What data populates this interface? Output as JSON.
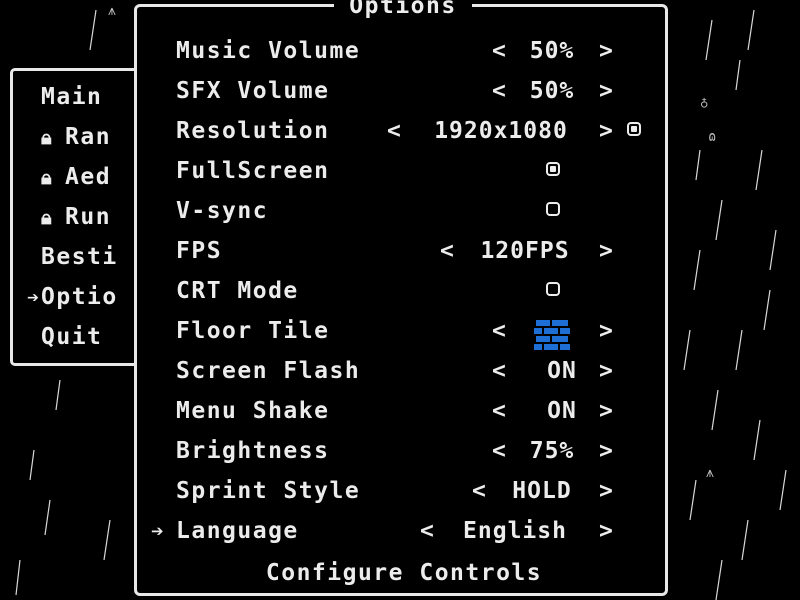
{
  "background": {
    "color": "#000000",
    "rain_color": "#d8d8d8",
    "tree_icon": "tree-icon"
  },
  "main_menu": {
    "items": [
      {
        "label": "Main",
        "locked": false,
        "selected": false
      },
      {
        "label": "Ran",
        "locked": true,
        "selected": false
      },
      {
        "label": "Aed",
        "locked": true,
        "selected": false
      },
      {
        "label": "Run",
        "locked": true,
        "selected": false
      },
      {
        "label": "Besti",
        "locked": false,
        "selected": false
      },
      {
        "label": "Optio",
        "locked": false,
        "selected": true
      },
      {
        "label": "Quit",
        "locked": false,
        "selected": false
      }
    ],
    "lock_icon": "lock-icon",
    "cursor_icon": "arrow-right-icon"
  },
  "options": {
    "title": "Options",
    "rows": [
      {
        "label": "Music Volume",
        "value": "50%",
        "control": "selector"
      },
      {
        "label": "SFX Volume",
        "value": "50%",
        "control": "selector"
      },
      {
        "label": "Resolution",
        "value": "1920x1080",
        "control": "selector",
        "extra_checkbox_on": true
      },
      {
        "label": "FullScreen",
        "checked": true,
        "control": "checkbox"
      },
      {
        "label": "V-sync",
        "checked": false,
        "control": "checkbox"
      },
      {
        "label": "FPS",
        "value": "120FPS",
        "control": "selector"
      },
      {
        "label": "CRT Mode",
        "checked": false,
        "control": "checkbox"
      },
      {
        "label": "Floor Tile",
        "control": "tile",
        "tile_color": "#1d6fd6"
      },
      {
        "label": "Screen Flash",
        "value": "ON",
        "control": "selector"
      },
      {
        "label": "Menu Shake",
        "value": "ON",
        "control": "selector"
      },
      {
        "label": "Brightness",
        "value": "75%",
        "control": "selector"
      },
      {
        "label": "Sprint Style",
        "value": "HOLD",
        "control": "selector"
      },
      {
        "label": "Language",
        "value": "English",
        "control": "selector",
        "selected": true
      }
    ],
    "left_arrow": "<",
    "right_arrow": ">",
    "configure_label": "Configure Controls"
  },
  "colors": {
    "text": "#ececec",
    "border": "#e8e8e8",
    "tile_blue": "#1d6fd6"
  }
}
